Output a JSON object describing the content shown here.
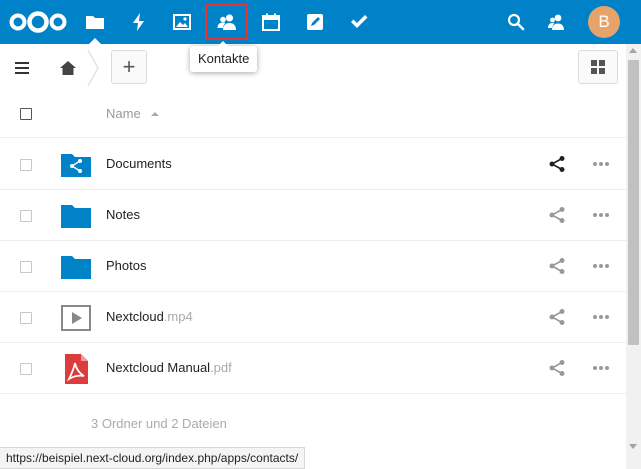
{
  "colors": {
    "brand": "#0082c9",
    "avatar": "#e8a36a",
    "highlight": "#e9322d"
  },
  "header": {
    "apps": [
      {
        "name": "files",
        "icon": "folder-icon",
        "active": true
      },
      {
        "name": "activity",
        "icon": "lightning-icon"
      },
      {
        "name": "gallery",
        "icon": "image-icon"
      },
      {
        "name": "contacts",
        "icon": "contacts-icon",
        "highlighted": true
      },
      {
        "name": "calendar",
        "icon": "calendar-icon"
      },
      {
        "name": "notes",
        "icon": "notes-icon"
      },
      {
        "name": "tasks",
        "icon": "checkmark-icon"
      }
    ],
    "search_icon": "search-icon",
    "contacts_menu_icon": "contacts-menu-icon",
    "avatar_initial": "B"
  },
  "tooltip": {
    "text": "Kontakte"
  },
  "controls": {
    "add_label": "+"
  },
  "table": {
    "column_name": "Name",
    "rows": [
      {
        "name": "Documents",
        "ext": "",
        "icon": "shared-folder-icon",
        "shared": true
      },
      {
        "name": "Notes",
        "ext": "",
        "icon": "folder-icon",
        "shared": false
      },
      {
        "name": "Photos",
        "ext": "",
        "icon": "folder-icon",
        "shared": false
      },
      {
        "name": "Nextcloud",
        "ext": ".mp4",
        "icon": "video-file-icon",
        "shared": false
      },
      {
        "name": "Nextcloud Manual",
        "ext": ".pdf",
        "icon": "pdf-file-icon",
        "shared": false
      }
    ],
    "summary": "3 Ordner und 2 Dateien"
  },
  "statusbar": {
    "url": "https://beispiel.next-cloud.org/index.php/apps/contacts/"
  }
}
